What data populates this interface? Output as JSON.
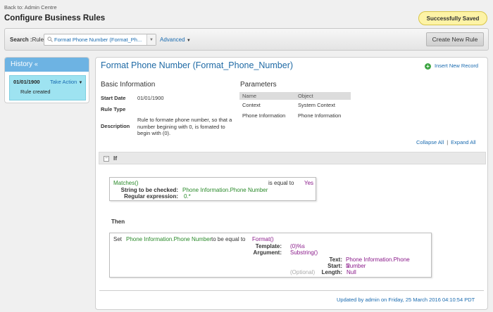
{
  "header": {
    "back_link": "Back to: Admin Centre",
    "page_title": "Configure Business Rules",
    "saved_badge": "Successfully Saved"
  },
  "search": {
    "label": "Search :",
    "type_label": "Rule",
    "selected_rule": "Format Phone Number (Format_Ph...",
    "advanced_label": "Advanced",
    "create_button": "Create New Rule"
  },
  "history": {
    "title": "History",
    "toggle": "«",
    "entry": {
      "date": "01/01/1900",
      "action": "Take Action",
      "text": "Rule created"
    }
  },
  "rule": {
    "title": "Format Phone Number (Format_Phone_Number)",
    "insert_record": "Insert New Record",
    "basic_info_title": "Basic Information",
    "start_date_label": "Start Date",
    "start_date": "01/01/1900",
    "rule_type_label": "Rule Type",
    "rule_type": "",
    "description_label": "Description",
    "description": "Rule to formate phone number, so that a number begining with 0, is fomated to begin with (0).",
    "parameters_title": "Parameters",
    "parameters_headers": [
      "Name",
      "Object"
    ],
    "parameters": [
      {
        "name": "Context",
        "object": "System Context"
      },
      {
        "name": "Phone Information",
        "object": "Phone Information"
      }
    ],
    "collapse_all": "Collapse All",
    "separator": "|",
    "expand_all": "Expand All"
  },
  "condition": {
    "if_label": "If",
    "if_toggle": "−",
    "function": "Matches()",
    "operator": "is equal to",
    "value": "Yes",
    "arg1_label": "String to be checked:",
    "arg1_value": "Phone Information.Phone Number",
    "arg2_label": "Regular expression:",
    "arg2_value": "0.*"
  },
  "action": {
    "then_label": "Then",
    "set_label": "Set",
    "target": "Phone Information.Phone Number",
    "to_label": "to be equal to",
    "function": "Format()",
    "template_label": "Template:",
    "template_value": "(0)%s",
    "argument_label": "Argument:",
    "argument_value": "Substring()",
    "text_label": "Text:",
    "text_value": "Phone Information.Phone Number",
    "start_label": "Start:",
    "start_value": "2",
    "optional_label": "(Optional)",
    "length_label": "Length:",
    "length_value": "Null"
  },
  "footer": {
    "updated": "Updated by admin on Friday, 25 March 2016 04:10:54 PDT"
  },
  "colors": {
    "accent_blue": "#1f6aa5",
    "history_header": "#6db3e3",
    "history_entry": "#9ee3f1",
    "green_value": "#2a8a2a",
    "purple_value": "#8a1a8a",
    "badge_bg": "#fdf3a6"
  }
}
